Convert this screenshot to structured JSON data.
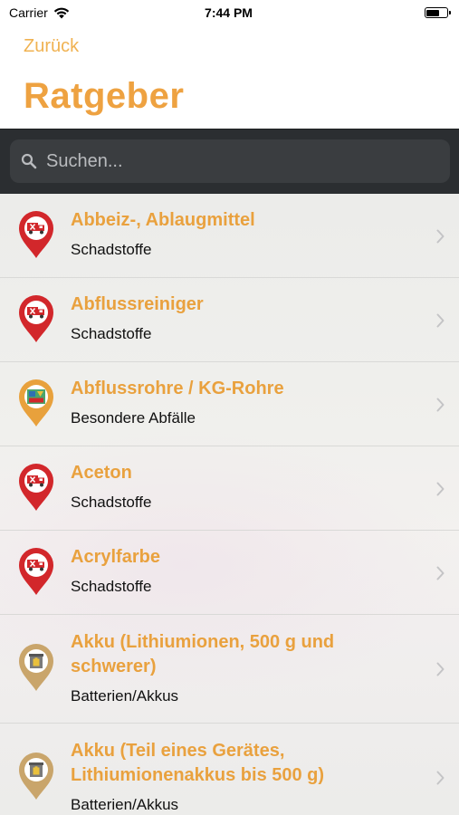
{
  "status_bar": {
    "carrier": "Carrier",
    "time": "7:44 PM"
  },
  "nav": {
    "back_label": "Zurück",
    "title": "Ratgeber"
  },
  "search": {
    "placeholder": "Suchen..."
  },
  "colors": {
    "accent": "#eea241",
    "pin_red": "#d2272b",
    "pin_orange": "#e8a13c",
    "pin_tan": "#c9a56b"
  },
  "items": [
    {
      "title_lines": [
        "Abbeiz-, Ablaugmittel"
      ],
      "subtitle": "Schadstoffe",
      "icon": "hazardous-truck-pin-icon"
    },
    {
      "title_lines": [
        "Abflussreiniger"
      ],
      "subtitle": "Schadstoffe",
      "icon": "hazardous-truck-pin-icon"
    },
    {
      "title_lines": [
        "Abflussrohre / KG-Rohre"
      ],
      "subtitle": "Besondere Abfälle",
      "icon": "special-waste-pin-icon"
    },
    {
      "title_lines": [
        "Aceton"
      ],
      "subtitle": "Schadstoffe",
      "icon": "hazardous-truck-pin-icon"
    },
    {
      "title_lines": [
        "Acrylfarbe"
      ],
      "subtitle": "Schadstoffe",
      "icon": "hazardous-truck-pin-icon"
    },
    {
      "title_lines": [
        "Akku (Lithiumionen, 500 g und",
        "schwerer)"
      ],
      "subtitle": "Batterien/Akkus",
      "icon": "battery-bin-pin-icon"
    },
    {
      "title_lines": [
        "Akku (Teil eines Gerätes,",
        "Lithiumionenakkus bis 500 g)"
      ],
      "subtitle": "Batterien/Akkus",
      "icon": "battery-bin-pin-icon"
    }
  ]
}
